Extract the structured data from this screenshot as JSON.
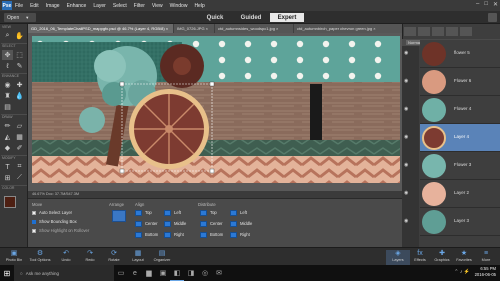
{
  "menu": [
    "File",
    "Edit",
    "Image",
    "Enhance",
    "Layer",
    "Select",
    "Filter",
    "View",
    "Window",
    "Help"
  ],
  "app_logo": "Pse",
  "window_controls": [
    "–",
    "□",
    "✕"
  ],
  "open_button": "Open",
  "mode_tabs": [
    "Quick",
    "Guided",
    "Expert"
  ],
  "active_mode": "Expert",
  "file_tabs": [
    "GD_2016_06_TemplateChallPSD_mappgfx.psd @ 46.7% (Layer 4, RGB/8) ×",
    "IMG_0726.JPG ×",
    "ctd_autumnsides_woodspc1.jpg ×",
    "ctd_autumnbirch_paper chevron green.jpg ×"
  ],
  "status_bar": "46.67%   Doc: 37.7M/547.3M",
  "tool_groups": [
    "VIEW",
    "SELECT",
    "ENHANCE",
    "DRAW",
    "MODIFY",
    "COLOR"
  ],
  "options": {
    "move_title": "Move",
    "auto_select": "Auto Select Layer",
    "show_bounding": "Show Bounding Box",
    "show_highlight": "Show Highlight on Rollover",
    "arrange": "Arrange",
    "align": "Align",
    "align_items": [
      "Top",
      "Left",
      "Center",
      "Middle",
      "Bottom",
      "Right"
    ],
    "distribute": "Distribute",
    "distribute_items": [
      "Top",
      "Left",
      "Center",
      "Middle",
      "Bottom",
      "Right"
    ]
  },
  "layers_panel": {
    "blend_mode": "Normal",
    "opacity_label": "Opacity:",
    "opacity_value": "100%",
    "layers": [
      "flower 5",
      "Flower 6",
      "Flower 4",
      "Layer 4",
      "Flower 3",
      "Layer 2",
      "Layer 3"
    ],
    "selected": "Layer 4"
  },
  "bottom_left": [
    "Photo Bin",
    "Tool Options",
    "Undo",
    "Redo",
    "Rotate",
    "Layout",
    "Organizer"
  ],
  "bottom_right": [
    "Layers",
    "Effects",
    "Graphics",
    "Favorites",
    "More"
  ],
  "taskbar": {
    "search_placeholder": "Ask me anything",
    "time": "6:55 PM",
    "date": "2016-06-05"
  },
  "colors": {
    "teal": "#5ea49a",
    "wood": "#8a6a58",
    "chevron_peach": "#d9a48c",
    "brand_blue": "#2a6db5",
    "selected_layer": "#5a83b8"
  }
}
